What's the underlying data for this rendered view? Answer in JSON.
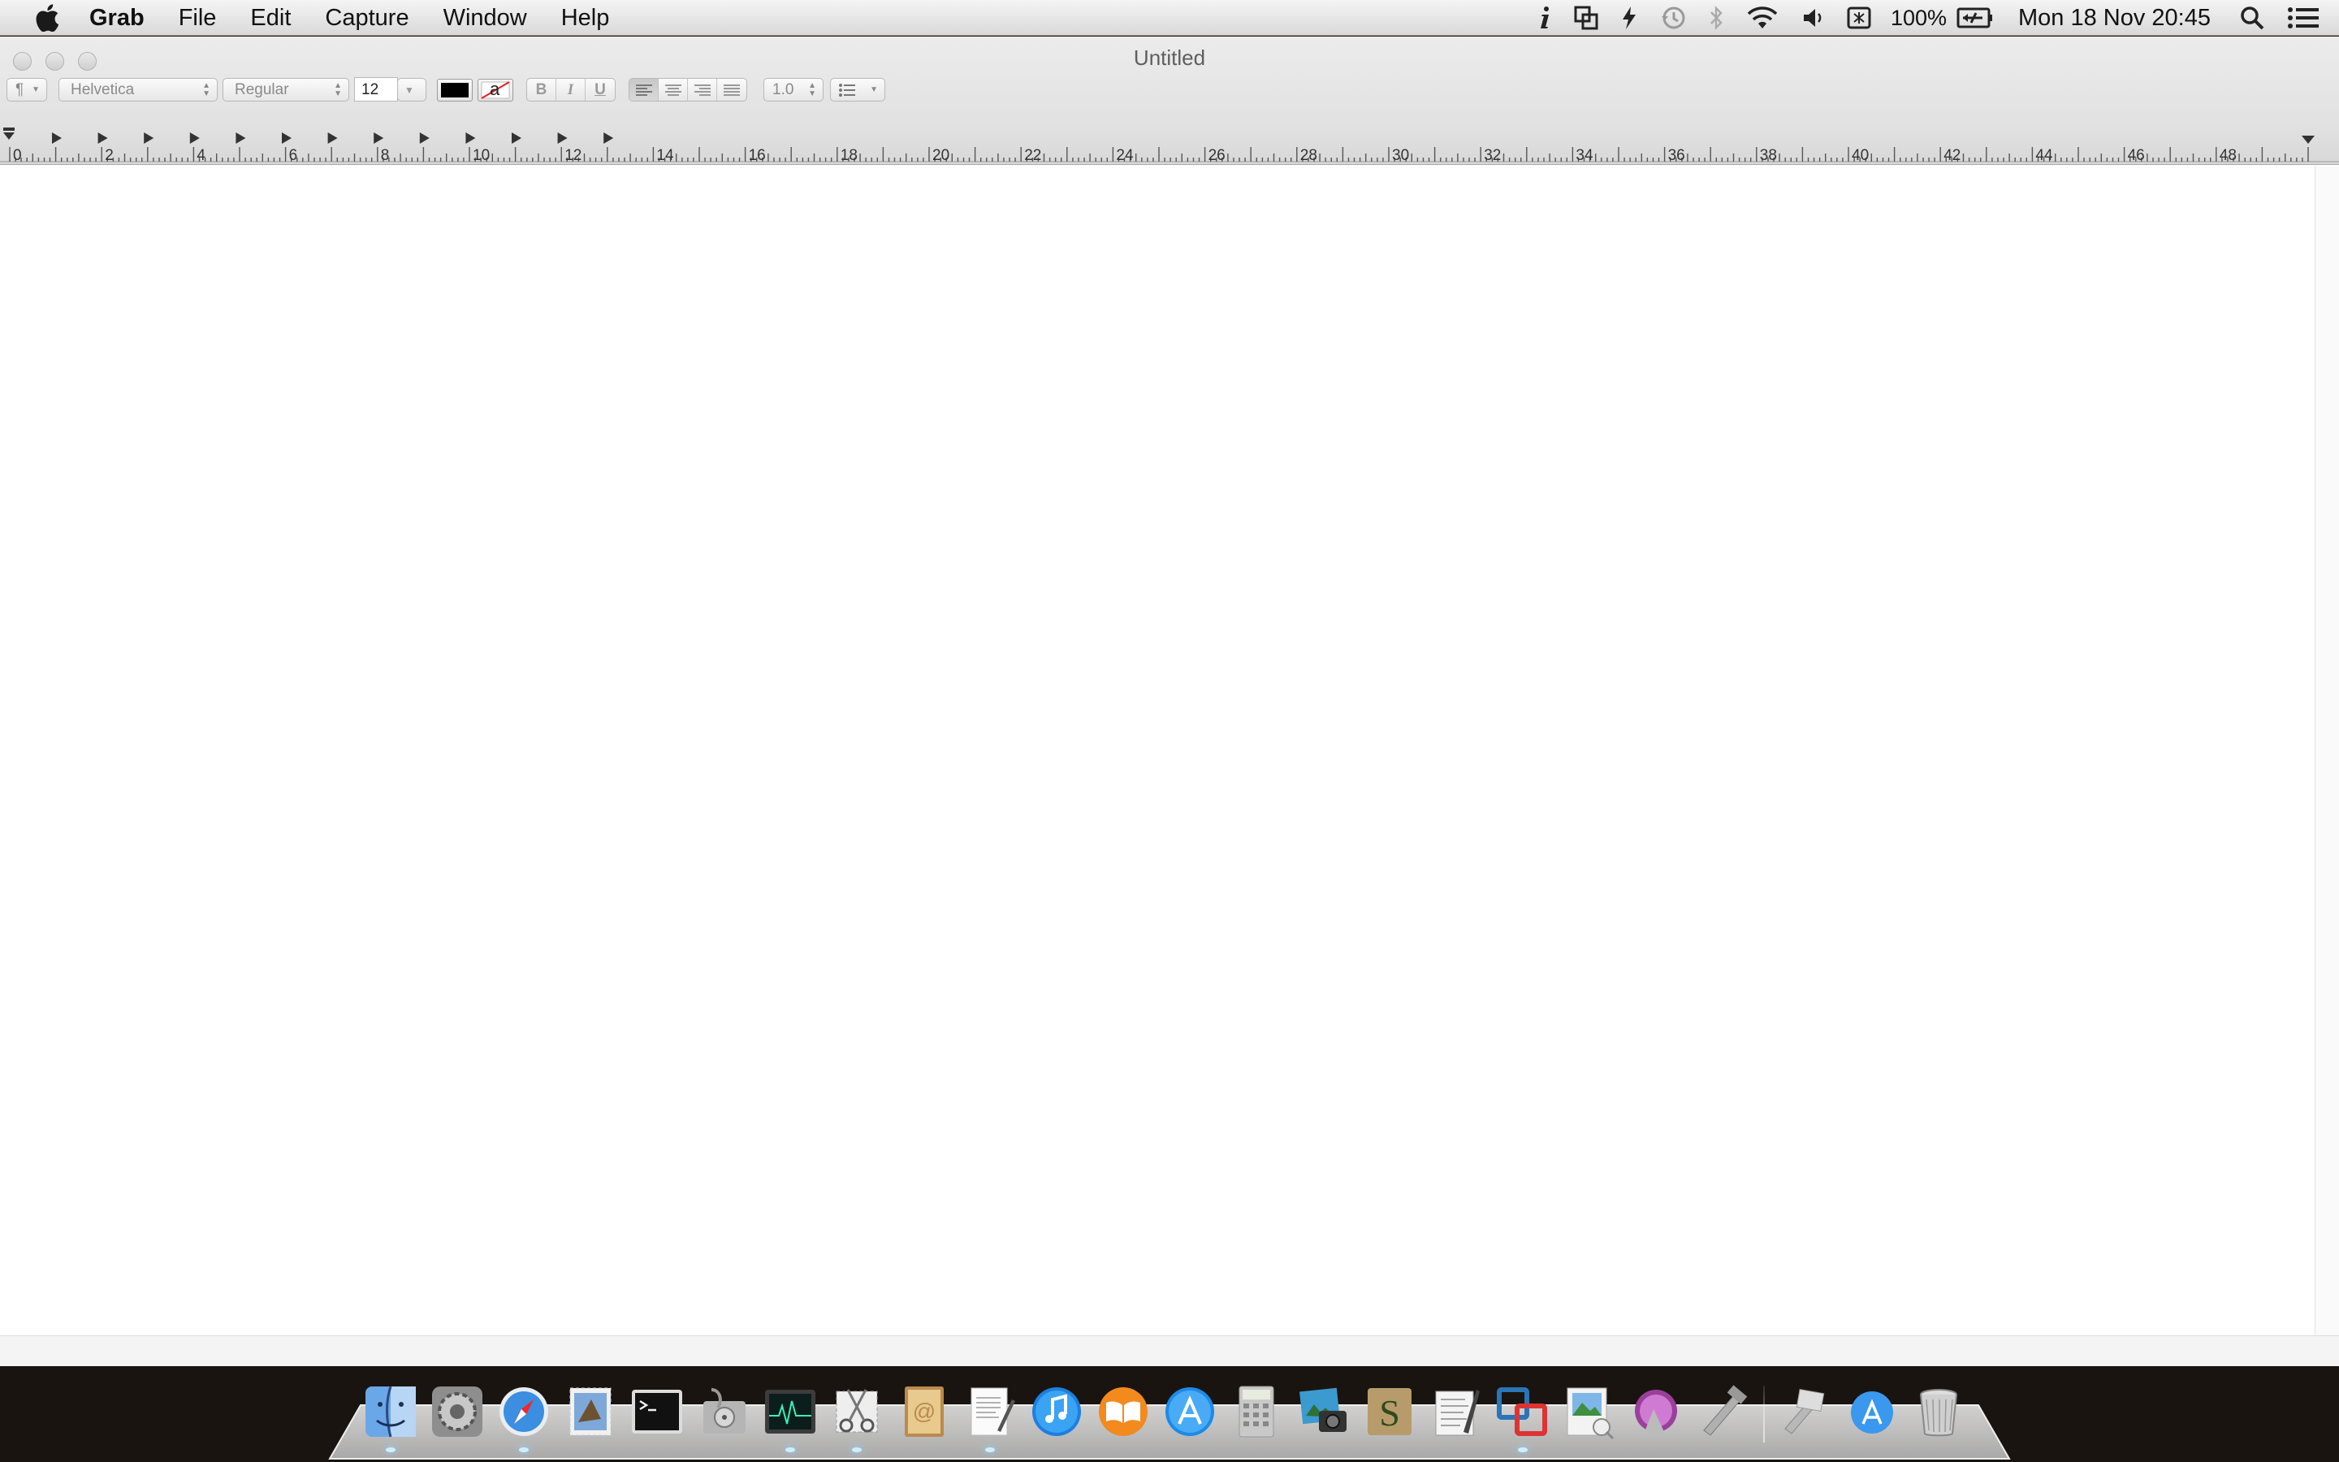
{
  "menubar": {
    "app_name": "Grab",
    "items": [
      "File",
      "Edit",
      "Capture",
      "Window",
      "Help"
    ],
    "battery_percent": "100%",
    "clock": "Mon 18 Nov  20:45",
    "status_icons": [
      "info-icon",
      "screen-mirror-icon",
      "flash-icon",
      "time-machine-icon",
      "bluetooth-icon",
      "wifi-icon",
      "volume-icon",
      "input-source-icon",
      "battery-icon",
      "spotlight-icon",
      "notification-center-icon"
    ]
  },
  "window": {
    "title": "Untitled"
  },
  "formatbar": {
    "paragraph_style": "¶",
    "font_family": "Helvetica",
    "font_style": "Regular",
    "font_size": "12",
    "bold": "B",
    "italic": "I",
    "underline": "U",
    "highlight_letter": "a",
    "line_spacing": "1.0",
    "text_color": "#000000"
  },
  "ruler": {
    "labels": [
      "0",
      "2",
      "4",
      "6",
      "8",
      "10",
      "12",
      "14",
      "16",
      "18",
      "20",
      "22",
      "24",
      "26",
      "28",
      "30",
      "32",
      "34",
      "36",
      "38",
      "40",
      "42",
      "44",
      "46",
      "48"
    ]
  },
  "dock": {
    "apps": [
      "finder",
      "system-preferences",
      "safari",
      "mail",
      "terminal",
      "disk-utility",
      "activity-monitor",
      "grab",
      "contacts",
      "textedit",
      "itunes",
      "ibooks",
      "app-store",
      "calculator",
      "image-capture",
      "scrivener",
      "script-editor",
      "vmware-fusion",
      "preview",
      "instruments",
      "xcode-tools"
    ],
    "right_items": [
      "utilities-folder",
      "applications-folder",
      "trash"
    ]
  }
}
